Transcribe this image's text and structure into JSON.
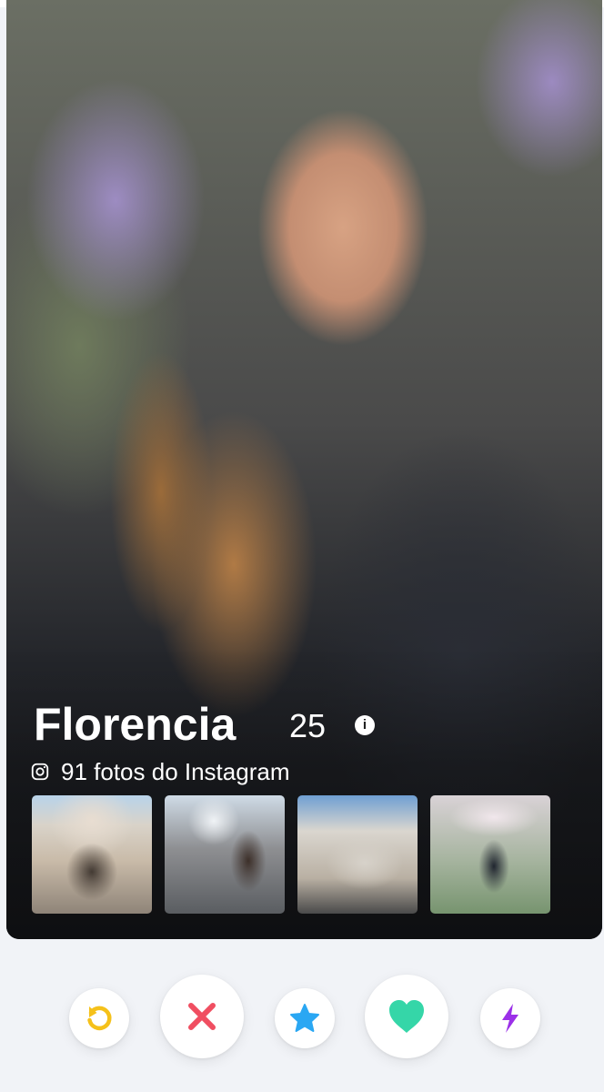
{
  "profile": {
    "name": "Florencia",
    "age": "25",
    "info_glyph": "i",
    "instagram_text": "91 fotos do Instagram",
    "instagram_icon": "instagram-icon"
  },
  "thumbnails": [
    {
      "name": "instagram-photo-1",
      "subject": "ornate building facade"
    },
    {
      "name": "instagram-photo-2",
      "subject": "woman with telescope"
    },
    {
      "name": "instagram-photo-3",
      "subject": "building with balconies"
    },
    {
      "name": "instagram-photo-4",
      "subject": "woman among blossoms"
    }
  ],
  "actions": [
    {
      "name": "rewind-button",
      "icon": "rewind-icon",
      "color": "#f5c11a"
    },
    {
      "name": "nope-button",
      "icon": "close-icon",
      "color": "#f04e61"
    },
    {
      "name": "super-like-button",
      "icon": "star-icon",
      "color": "#2aa7f3"
    },
    {
      "name": "like-button",
      "icon": "heart-icon",
      "color": "#35d6a8"
    },
    {
      "name": "boost-button",
      "icon": "bolt-icon",
      "color": "#9b30e8"
    }
  ],
  "colors": {
    "background": "#f1f3f7",
    "card_overlay_text": "#ffffff"
  }
}
